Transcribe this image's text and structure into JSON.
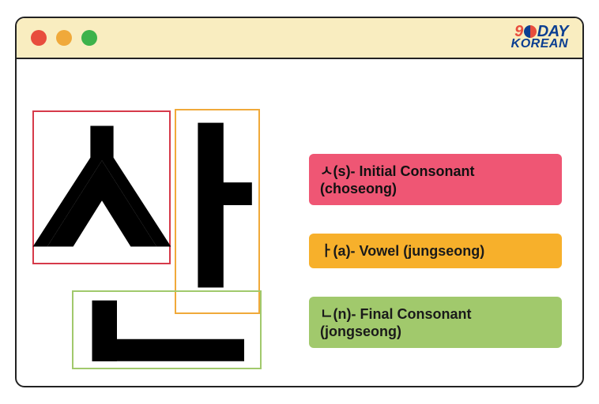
{
  "brand": {
    "top_pre": "9",
    "top_post": "DAY",
    "bottom": "KOREAN"
  },
  "syllable": {
    "initial_glyph": "ㅅ",
    "vowel_glyph": "ㅏ",
    "final_glyph": "ㄴ"
  },
  "labels": {
    "initial": "ㅅ(s)- Initial Consonant (choseong)",
    "vowel": "ㅏ(a)- Vowel (jungseong)",
    "final": "ㄴ(n)- Final Consonant (jongseong)"
  },
  "boxes": {
    "initial_color": "#d63a4a",
    "vowel_color": "#f0a93a",
    "final_color": "#a1c96c"
  },
  "label_colors": {
    "initial": "#ef5674",
    "vowel": "#f7b02b",
    "final": "#a1c96c"
  }
}
